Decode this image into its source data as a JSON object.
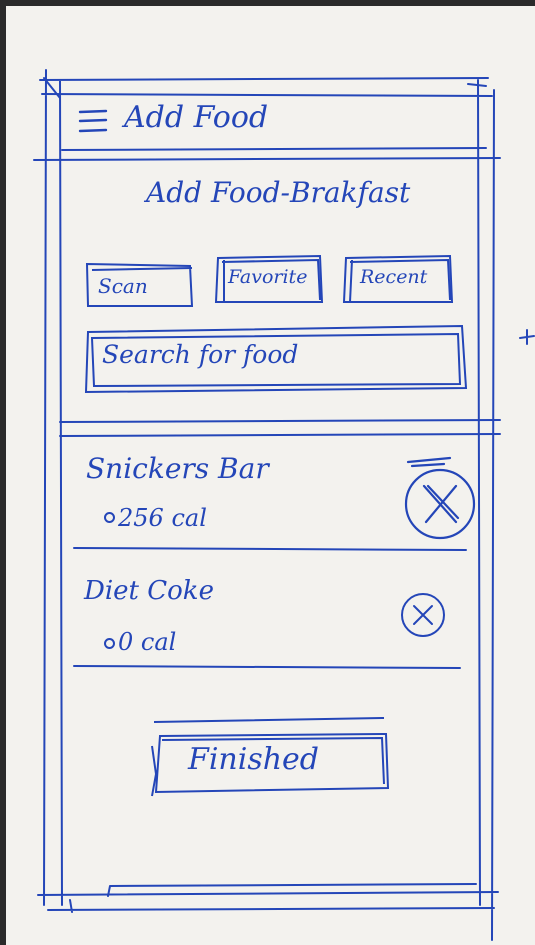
{
  "header": {
    "menu_icon": "hamburger-menu-icon",
    "title": "Add Food"
  },
  "page_title": "Add Food-Brakfast",
  "tabs": [
    {
      "label": "Scan"
    },
    {
      "label": "Favorite"
    },
    {
      "label": "Recent"
    }
  ],
  "search": {
    "placeholder": "Search for food"
  },
  "food_items": [
    {
      "name": "Snickers Bar",
      "calories": "256 cal",
      "remove_icon": "remove-x-circle-icon"
    },
    {
      "name": "Diet Coke",
      "calories": "0 cal",
      "remove_icon": "remove-x-circle-icon"
    }
  ],
  "finish_button": {
    "label": "Finished"
  },
  "colors": {
    "ink": "#2446b8",
    "paper": "#f3f2ee",
    "background": "#2a2a2a"
  }
}
